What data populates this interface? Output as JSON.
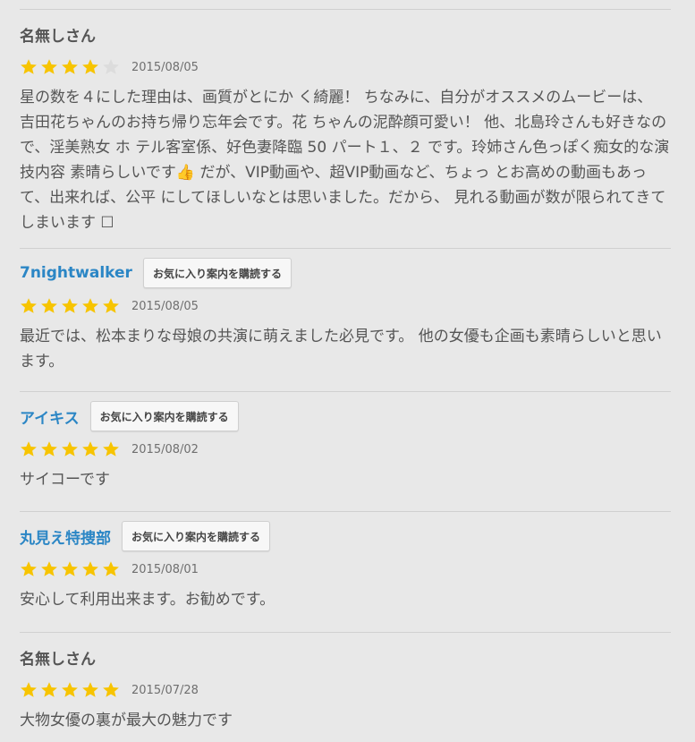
{
  "colors": {
    "accent_link": "#2b86c5",
    "star_filled": "#f7c400",
    "star_empty": "#dcdcdc",
    "background": "#e8e8e8"
  },
  "reviews": [
    {
      "name": "名無しさん",
      "date": "2015/08/05",
      "stars": 4,
      "body": "星の数を４にした理由は、画質がとにか く綺麗！ ちなみに、自分がオススメのムービーは、 吉田花ちゃんのお持ち帰り忘年会です。花 ちゃんの泥酔顔可愛い！ 他、北島玲さんも好きなので、淫美熟女 ホ テル客室係、好色妻降臨 50 パート１、２ です。玲姉さん色っぽく痴女的な演技内容 素晴らしいです👍 だが、VIP動画や、超VIP動画など、ちょっ とお高めの動画もあって、出来れば、公平 にしてほしいなとは思いました。だから、 見れる動画が数が限られてきてしまいます ☐"
    },
    {
      "name": "7nightwalker",
      "subscribe_label": "お気に入り案内を購読する",
      "date": "2015/08/05",
      "stars": 5,
      "body": "最近では、松本まりな母娘の共演に萌えました必見です。 他の女優も企画も素晴らしいと思います。"
    },
    {
      "name": "アイキス",
      "subscribe_label": "お気に入り案内を購読する",
      "date": "2015/08/02",
      "stars": 5,
      "body": "サイコーです"
    },
    {
      "name": "丸見え特捜部",
      "subscribe_label": "お気に入り案内を購読する",
      "date": "2015/08/01",
      "stars": 5,
      "body": "安心して利用出来ます。お勧めです。"
    },
    {
      "name": "名無しさん",
      "date": "2015/07/28",
      "stars": 5,
      "body": "大物女優の裏が最大の魅力です"
    }
  ]
}
